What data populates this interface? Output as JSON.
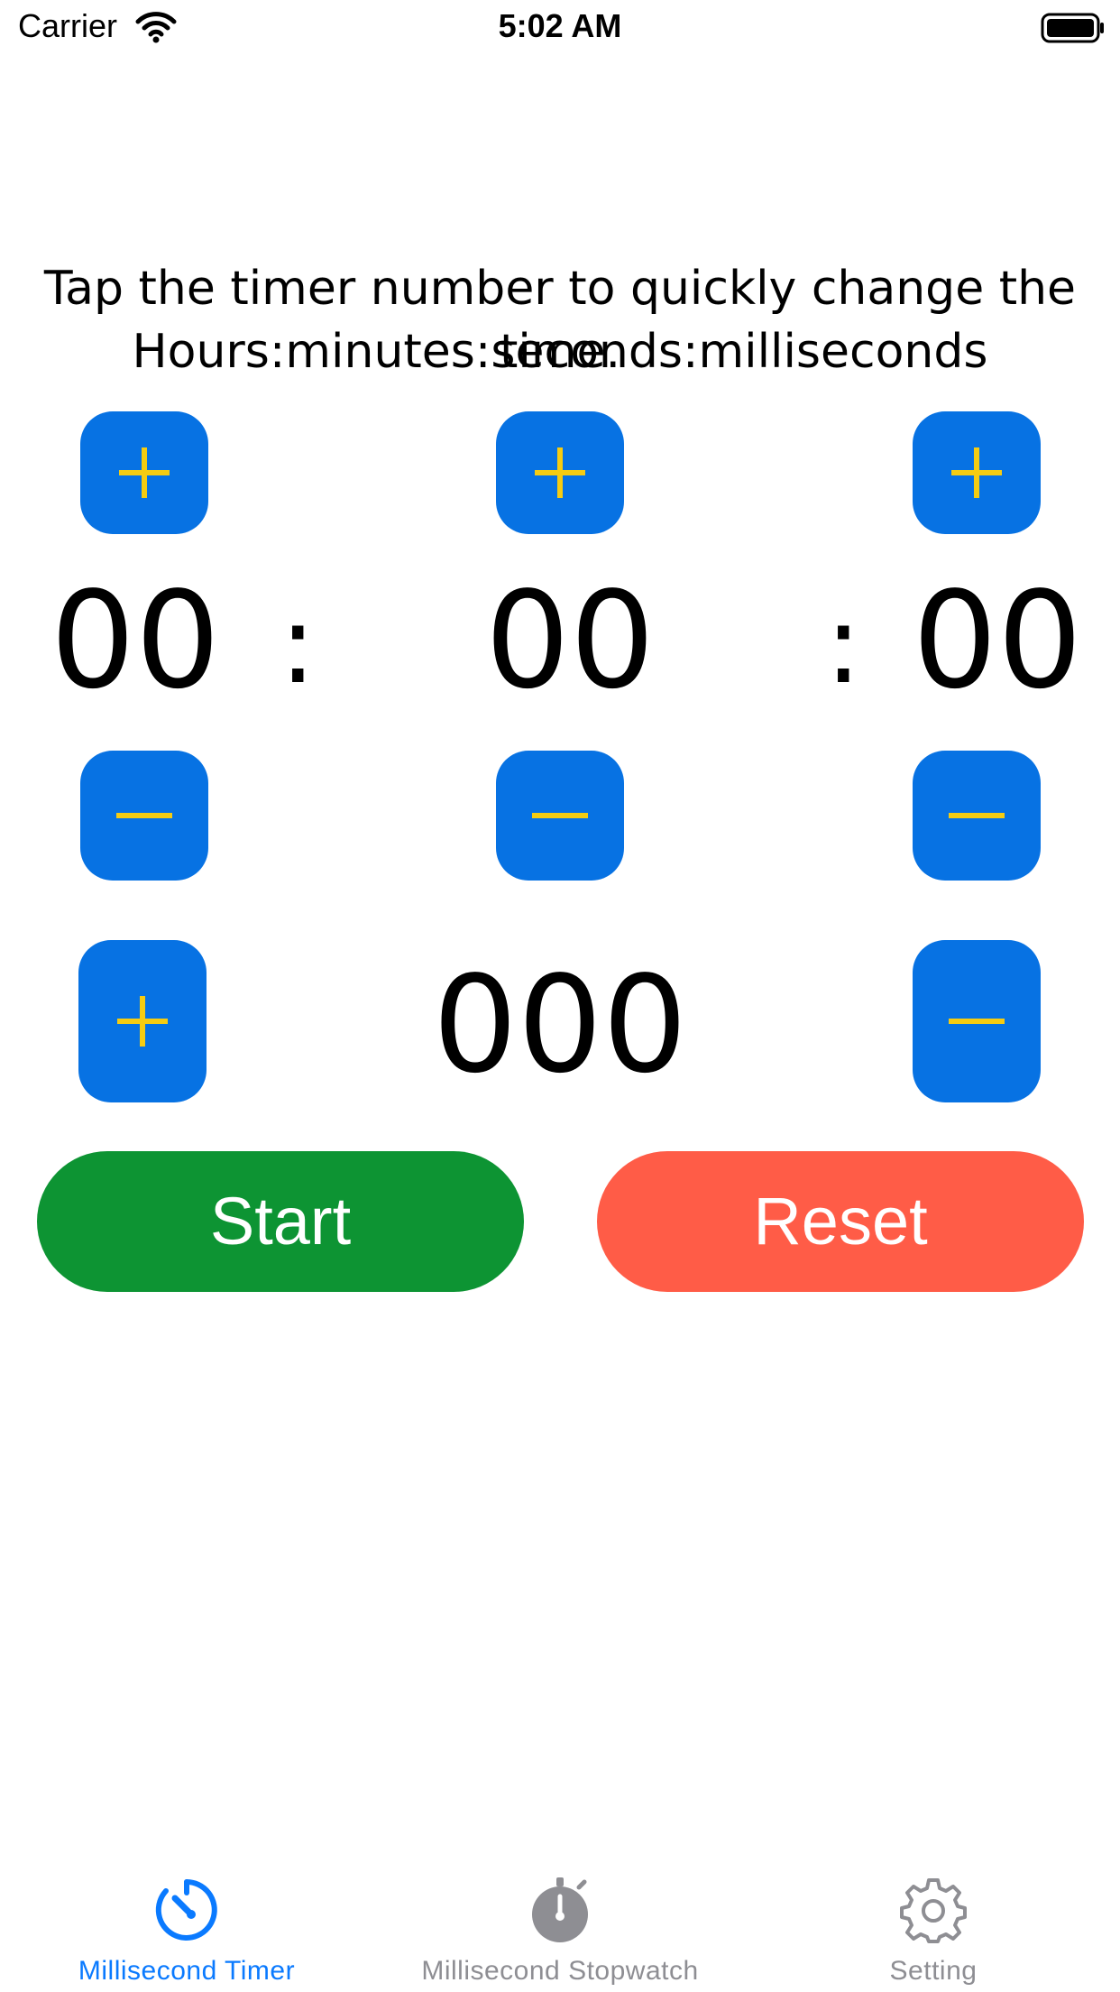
{
  "status_bar": {
    "carrier": "Carrier",
    "time": "5:02 AM"
  },
  "instructions": {
    "line1": "Tap the timer number to quickly change the time.",
    "line2": "Hours:minutes:seconds:milliseconds"
  },
  "timer": {
    "hours": "00",
    "minutes": "00",
    "seconds": "00",
    "separator": ":",
    "milliseconds": "000"
  },
  "buttons": {
    "start": "Start",
    "reset": "Reset"
  },
  "tabs": [
    {
      "label": "Millisecond Timer",
      "icon": "timer-icon",
      "active": true
    },
    {
      "label": "Millisecond Stopwatch",
      "icon": "stopwatch-icon",
      "active": false
    },
    {
      "label": "Setting",
      "icon": "gear-icon",
      "active": false
    }
  ],
  "colors": {
    "stepper_bg": "#0772e3",
    "stepper_glyph": "#f5cc12",
    "start": "#0d9433",
    "reset": "#ff5c47",
    "tab_active": "#0a7aff",
    "tab_inactive": "#8e8e93"
  }
}
